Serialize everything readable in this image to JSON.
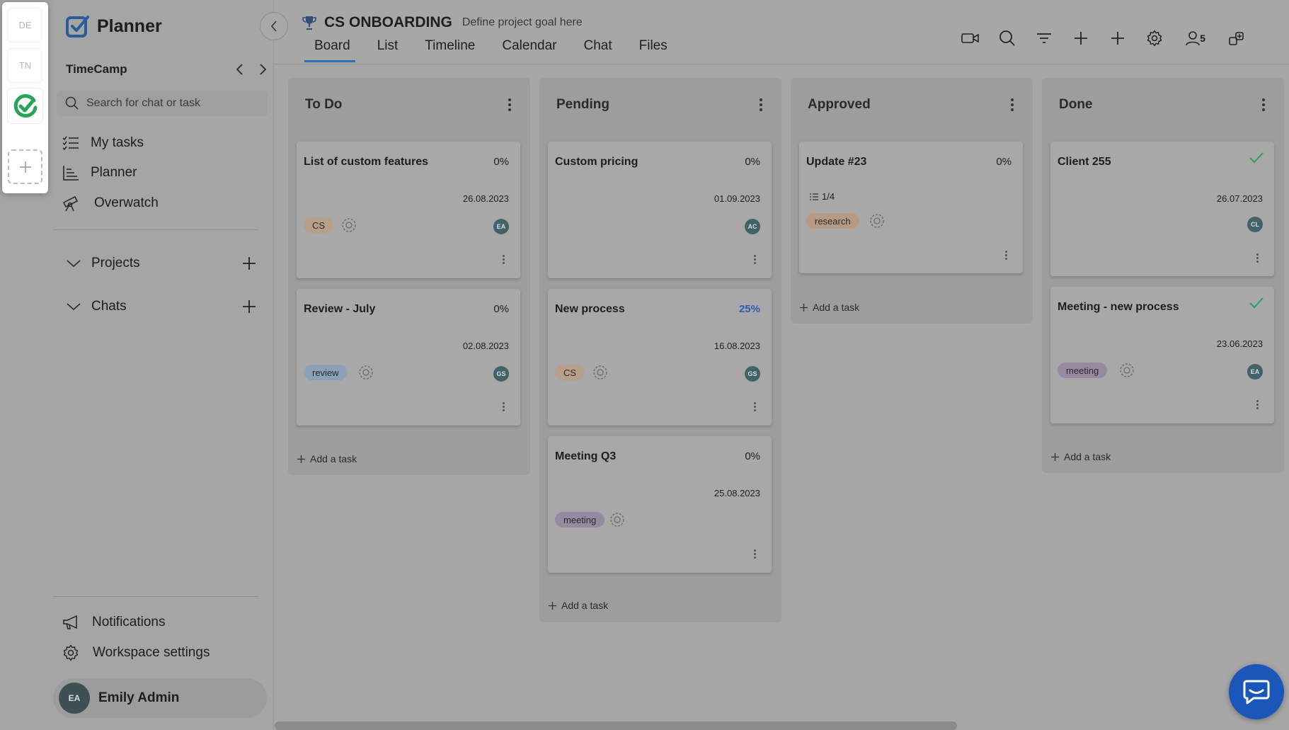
{
  "rail": {
    "workspaces": [
      "DE",
      "TN"
    ]
  },
  "sidebar": {
    "brand": "Planner",
    "workspace": "TimeCamp",
    "search_placeholder": "Search for chat or task",
    "nav": [
      {
        "label": "My tasks",
        "icon": "list-check-icon"
      },
      {
        "label": "Planner",
        "icon": "chart-icon"
      },
      {
        "label": "Overwatch",
        "icon": "telescope-icon"
      }
    ],
    "sections": [
      "Projects",
      "Chats"
    ],
    "bottom": [
      {
        "label": "Notifications",
        "icon": "megaphone-icon"
      },
      {
        "label": "Workspace settings",
        "icon": "gear-icon"
      }
    ],
    "user": {
      "initials": "EA",
      "name": "Emily Admin"
    }
  },
  "header": {
    "project_title": "CS ONBOARDING",
    "project_goal": "Define project goal here",
    "tabs": [
      "Board",
      "List",
      "Timeline",
      "Calendar",
      "Chat",
      "Files"
    ],
    "active_tab": "Board",
    "members_count": "5"
  },
  "board": {
    "add_task_label": "Add a task",
    "columns": [
      {
        "title": "To Do",
        "cards": [
          {
            "title": "List of custom features",
            "percent": "0%",
            "date": "26.08.2023",
            "tag": "CS",
            "avatar": "EA"
          },
          {
            "title": "Review - July",
            "percent": "0%",
            "date": "02.08.2023",
            "tag": "review",
            "avatar": "GS"
          }
        ]
      },
      {
        "title": "Pending",
        "cards": [
          {
            "title": "Custom pricing",
            "percent": "0%",
            "date": "01.09.2023",
            "avatar": "AC"
          },
          {
            "title": "New process",
            "percent": "25%",
            "date": "16.08.2023",
            "tag": "CS",
            "avatar": "GS"
          },
          {
            "title": "Meeting Q3",
            "percent": "0%",
            "date": "25.08.2023",
            "tag": "meeting"
          }
        ]
      },
      {
        "title": "Approved",
        "cards": [
          {
            "title": "Update #23",
            "percent": "0%",
            "subtasks": "1/4",
            "tag": "research"
          }
        ]
      },
      {
        "title": "Done",
        "cards": [
          {
            "title": "Client 255",
            "date": "26.07.2023",
            "avatar": "CL",
            "done": true
          },
          {
            "title": "Meeting - new process",
            "date": "23.06.2023",
            "tag": "meeting",
            "avatar": "EA",
            "done": true
          }
        ]
      }
    ]
  },
  "colors": {
    "accent_blue": "#2d6fb6",
    "check_green": "#27a35a",
    "chat_fab": "#1a57b8"
  }
}
